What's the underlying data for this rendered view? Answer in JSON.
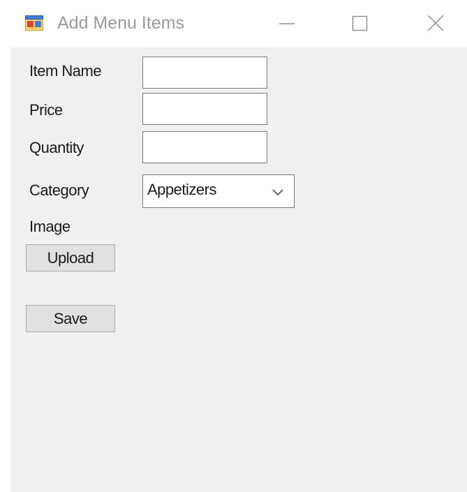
{
  "window": {
    "title": "Add Menu Items",
    "icon": "windows-form-icon"
  },
  "form": {
    "item_name_label": "Item Name",
    "item_name_value": "",
    "price_label": "Price",
    "price_value": "",
    "quantity_label": "Quantity",
    "quantity_value": "",
    "category_label": "Category",
    "category_value": "Appetizers",
    "image_label": "Image",
    "upload_button": "Upload",
    "save_button": "Save"
  },
  "colors": {
    "client_background": "#f0f0f0",
    "title_text": "#9a9a9a",
    "button_face": "#e1e1e1",
    "button_border": "#adadad",
    "textbox_border": "#7a7a7a"
  }
}
